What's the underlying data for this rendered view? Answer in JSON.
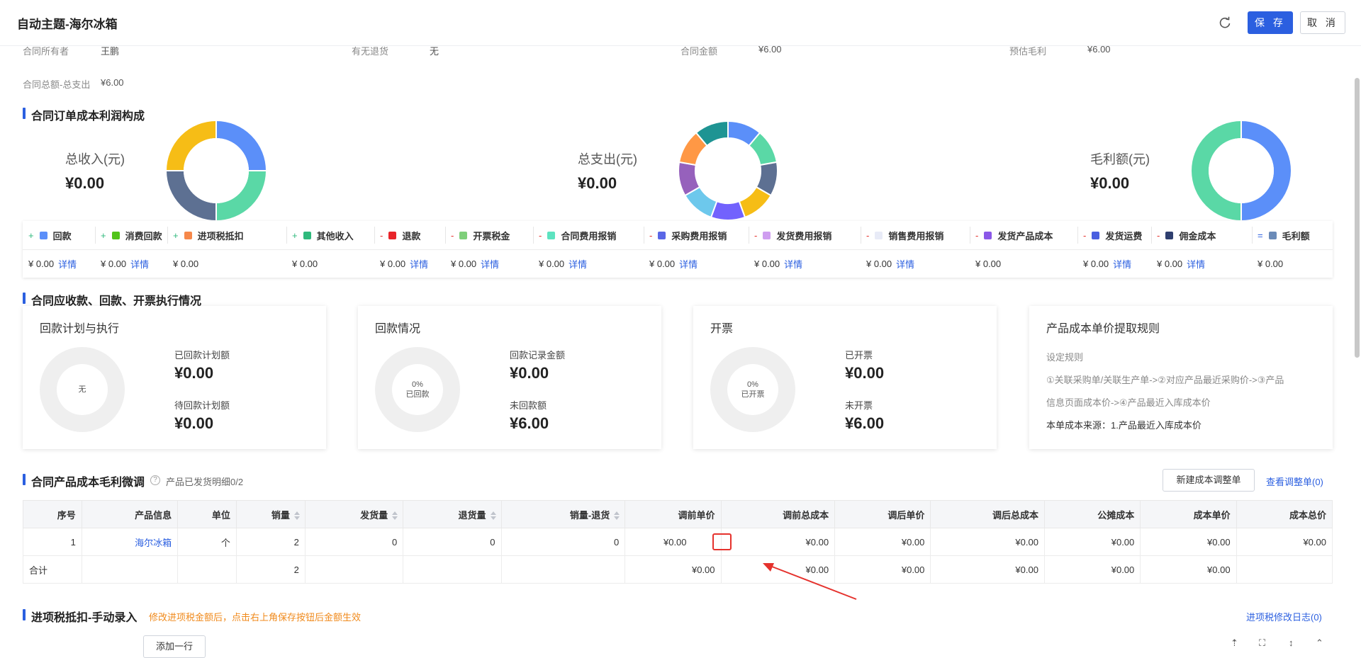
{
  "header": {
    "title": "自动主题-海尔冰箱",
    "save_label": "保 存",
    "cancel_label": "取 消"
  },
  "info": {
    "row1": [
      {
        "label": "合同所有者",
        "value": "王鹏"
      },
      {
        "label": "有无退货",
        "value": "无"
      },
      {
        "label": "合同金额",
        "value": "¥6.00"
      },
      {
        "label": "预估毛利",
        "value": "¥6.00"
      }
    ],
    "row2": {
      "label": "合同总额-总支出",
      "value": "¥6.00"
    }
  },
  "profit_section": {
    "title": "合同订单成本利润构成",
    "kpis": [
      {
        "label": "总收入(元)",
        "value": "¥0.00"
      },
      {
        "label": "总支出(元)",
        "value": "¥0.00"
      },
      {
        "label": "毛利额(元)",
        "value": "¥0.00"
      }
    ],
    "legend": [
      {
        "sign": "+",
        "name": "回款",
        "color": "#5b8ff9",
        "value": "¥ 0.00",
        "link": "详情"
      },
      {
        "sign": "+",
        "name": "消费回款",
        "color": "#52c41a",
        "value": "¥ 0.00",
        "link": "详情"
      },
      {
        "sign": "+",
        "name": "进项税抵扣",
        "color": "#f6884a",
        "value": "¥ 0.00",
        "link": ""
      },
      {
        "sign": "+",
        "name": "其他收入",
        "color": "#2fb97c",
        "value": "¥ 0.00",
        "link": ""
      },
      {
        "sign": "-",
        "name": "退款",
        "color": "#e8242a",
        "value": "¥ 0.00",
        "link": "详情"
      },
      {
        "sign": "-",
        "name": "开票税金",
        "color": "#7ecf7a",
        "value": "¥ 0.00",
        "link": "详情"
      },
      {
        "sign": "-",
        "name": "合同费用报销",
        "color": "#5de3c0",
        "value": "¥ 0.00",
        "link": "详情"
      },
      {
        "sign": "-",
        "name": "采购费用报销",
        "color": "#5a67e6",
        "value": "¥ 0.00",
        "link": "详情"
      },
      {
        "sign": "-",
        "name": "发货费用报销",
        "color": "#cf9ef0",
        "value": "¥ 0.00",
        "link": "详情"
      },
      {
        "sign": "-",
        "name": "销售费用报销",
        "color": "#e8ebf7",
        "value": "¥ 0.00",
        "link": "详情"
      },
      {
        "sign": "-",
        "name": "发货产品成本",
        "color": "#8b58e8",
        "value": "¥ 0.00",
        "link": ""
      },
      {
        "sign": "-",
        "name": "发货运费",
        "color": "#4a5fe0",
        "value": "¥ 0.00",
        "link": "详情"
      },
      {
        "sign": "-",
        "name": "佣金成本",
        "color": "#2f3f6f",
        "value": "¥ 0.00",
        "link": "详情"
      },
      {
        "sign": "=",
        "name": "毛利额",
        "color": "#6b8bb8",
        "value": "¥ 0.00",
        "link": ""
      }
    ]
  },
  "exec_section": {
    "title": "合同应收款、回款、开票执行情况",
    "cards": [
      {
        "title": "回款计划与执行",
        "center": [
          "无"
        ],
        "l1": "已回款计划额",
        "v1": "¥0.00",
        "l2": "待回款计划额",
        "v2": "¥0.00"
      },
      {
        "title": "回款情况",
        "center": [
          "0%",
          "已回款"
        ],
        "l1": "回款记录金额",
        "v1": "¥0.00",
        "l2": "未回款额",
        "v2": "¥6.00"
      },
      {
        "title": "开票",
        "center": [
          "0%",
          "已开票"
        ],
        "l1": "已开票",
        "v1": "¥0.00",
        "l2": "未开票",
        "v2": "¥6.00"
      }
    ],
    "rule_card": {
      "title": "产品成本单价提取规则",
      "sub": "设定规则",
      "line1": "①关联采购单/关联生产单->②对应产品最近采购价->③产品",
      "line2": "信息页面成本价->④产品最近入库成本价",
      "source": "本单成本来源：1.产品最近入库成本价"
    }
  },
  "product_section": {
    "title": "合同产品成本毛利微调",
    "hint": "产品已发货明细0/2",
    "new_button": "新建成本调整单",
    "view_link": "查看调整单(0)",
    "columns": [
      "序号",
      "产品信息",
      "单位",
      "销量",
      "发货量",
      "退货量",
      "销量-退货",
      "调前单价",
      "调前总成本",
      "调后单价",
      "调后总成本",
      "公摊成本",
      "成本单价",
      "成本总价"
    ],
    "row": [
      "1",
      "海尔冰箱",
      "个",
      "2",
      "0",
      "0",
      "0",
      "¥0.00",
      "¥0.00",
      "¥0.00",
      "¥0.00",
      "¥0.00",
      "¥0.00",
      "¥0.00"
    ],
    "total": [
      "合计",
      "",
      "",
      "2",
      "",
      "",
      "",
      "¥0.00",
      "¥0.00",
      "¥0.00",
      "¥0.00",
      "¥0.00",
      "¥0.00",
      ""
    ]
  },
  "tax_section": {
    "title": "进项税抵扣-手动录入",
    "warning": "修改进项税金额后，点击右上角保存按钮后金额生效",
    "log_link": "进项税修改日志(0)",
    "add_row": "添加一行"
  }
}
